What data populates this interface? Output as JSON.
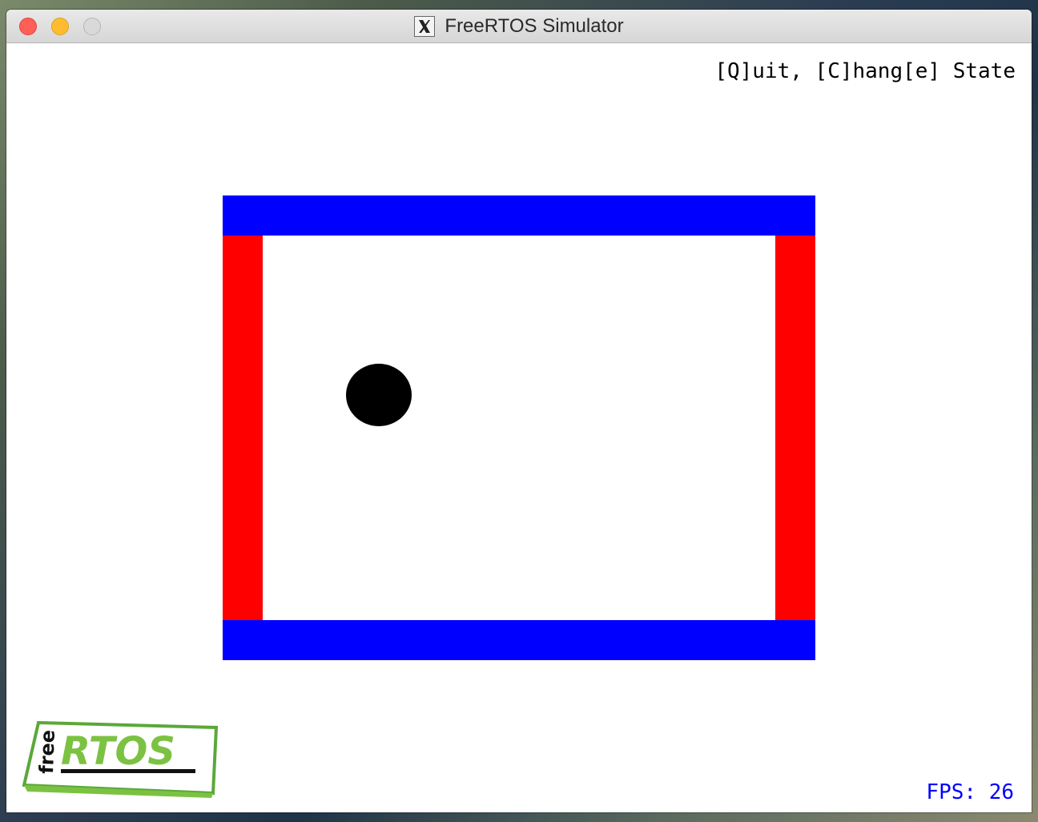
{
  "window": {
    "title": "FreeRTOS Simulator",
    "titlebar_icon": "x11-icon"
  },
  "hud": {
    "controls_hint": "[Q]uit, [C]hang[e] State",
    "fps_label": "FPS: 26"
  },
  "logo": {
    "text_free": "free",
    "text_rtos": "RTOS"
  },
  "colors": {
    "horizontal_walls": "#0000ff",
    "vertical_walls": "#ff0000",
    "ball": "#000000",
    "fps_text": "#0000ff",
    "logo_green": "#7cc242"
  }
}
